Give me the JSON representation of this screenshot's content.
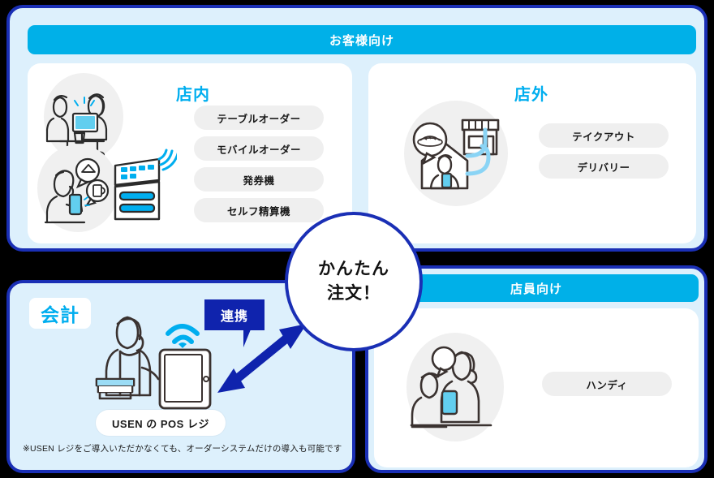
{
  "theme": {
    "background": "#000000",
    "panel_fill": "#dff0fc",
    "panel_border": "#1a2fb5",
    "accent_cyan": "#00b0e8",
    "accent_deep_blue": "#0f23ad",
    "pill_fill": "#efefef",
    "card_fill": "#ffffff",
    "illustration_circle": "#f0f0f0"
  },
  "customer_section": {
    "header": "お客様向け",
    "instore": {
      "heading": "店内",
      "illustrations": [
        {
          "name": "table-order-illustration",
          "caption": "テーブルで客がタブレットを見る"
        },
        {
          "name": "kiosk-illustration",
          "caption": "スマホを持つ客と券売機"
        }
      ],
      "buttons": [
        {
          "label": "テーブルオーダー"
        },
        {
          "label": "モバイルオーダー"
        },
        {
          "label": "発券機"
        },
        {
          "label": "セルフ精算機"
        }
      ]
    },
    "outstore": {
      "heading": "店外",
      "illustrations": [
        {
          "name": "takeout-delivery-illustration",
          "caption": "自宅からスマホで店に注文"
        }
      ],
      "buttons": [
        {
          "label": "テイクアウト"
        },
        {
          "label": "デリバリー"
        }
      ]
    }
  },
  "staff_section": {
    "header": "店員向け",
    "illustrations": [
      {
        "name": "staff-handy-illustration",
        "caption": "店員が客にハンディで注文を取る"
      }
    ],
    "buttons": [
      {
        "label": "ハンディ"
      }
    ]
  },
  "cashier_section": {
    "badge": "会計",
    "illustrations": [
      {
        "name": "pos-register-illustration",
        "caption": "店員とタブレットPOS、Wi-Fi"
      }
    ],
    "button": "USEN の POS レジ",
    "footnote": "※USEN レジをご導入いただかなくても、オーダーシステムだけの導入も可能です"
  },
  "center_bubble": {
    "line1": "かんたん",
    "line2": "注文！"
  },
  "connector": {
    "label": "連携",
    "arrow": "double-headed-arrow"
  }
}
